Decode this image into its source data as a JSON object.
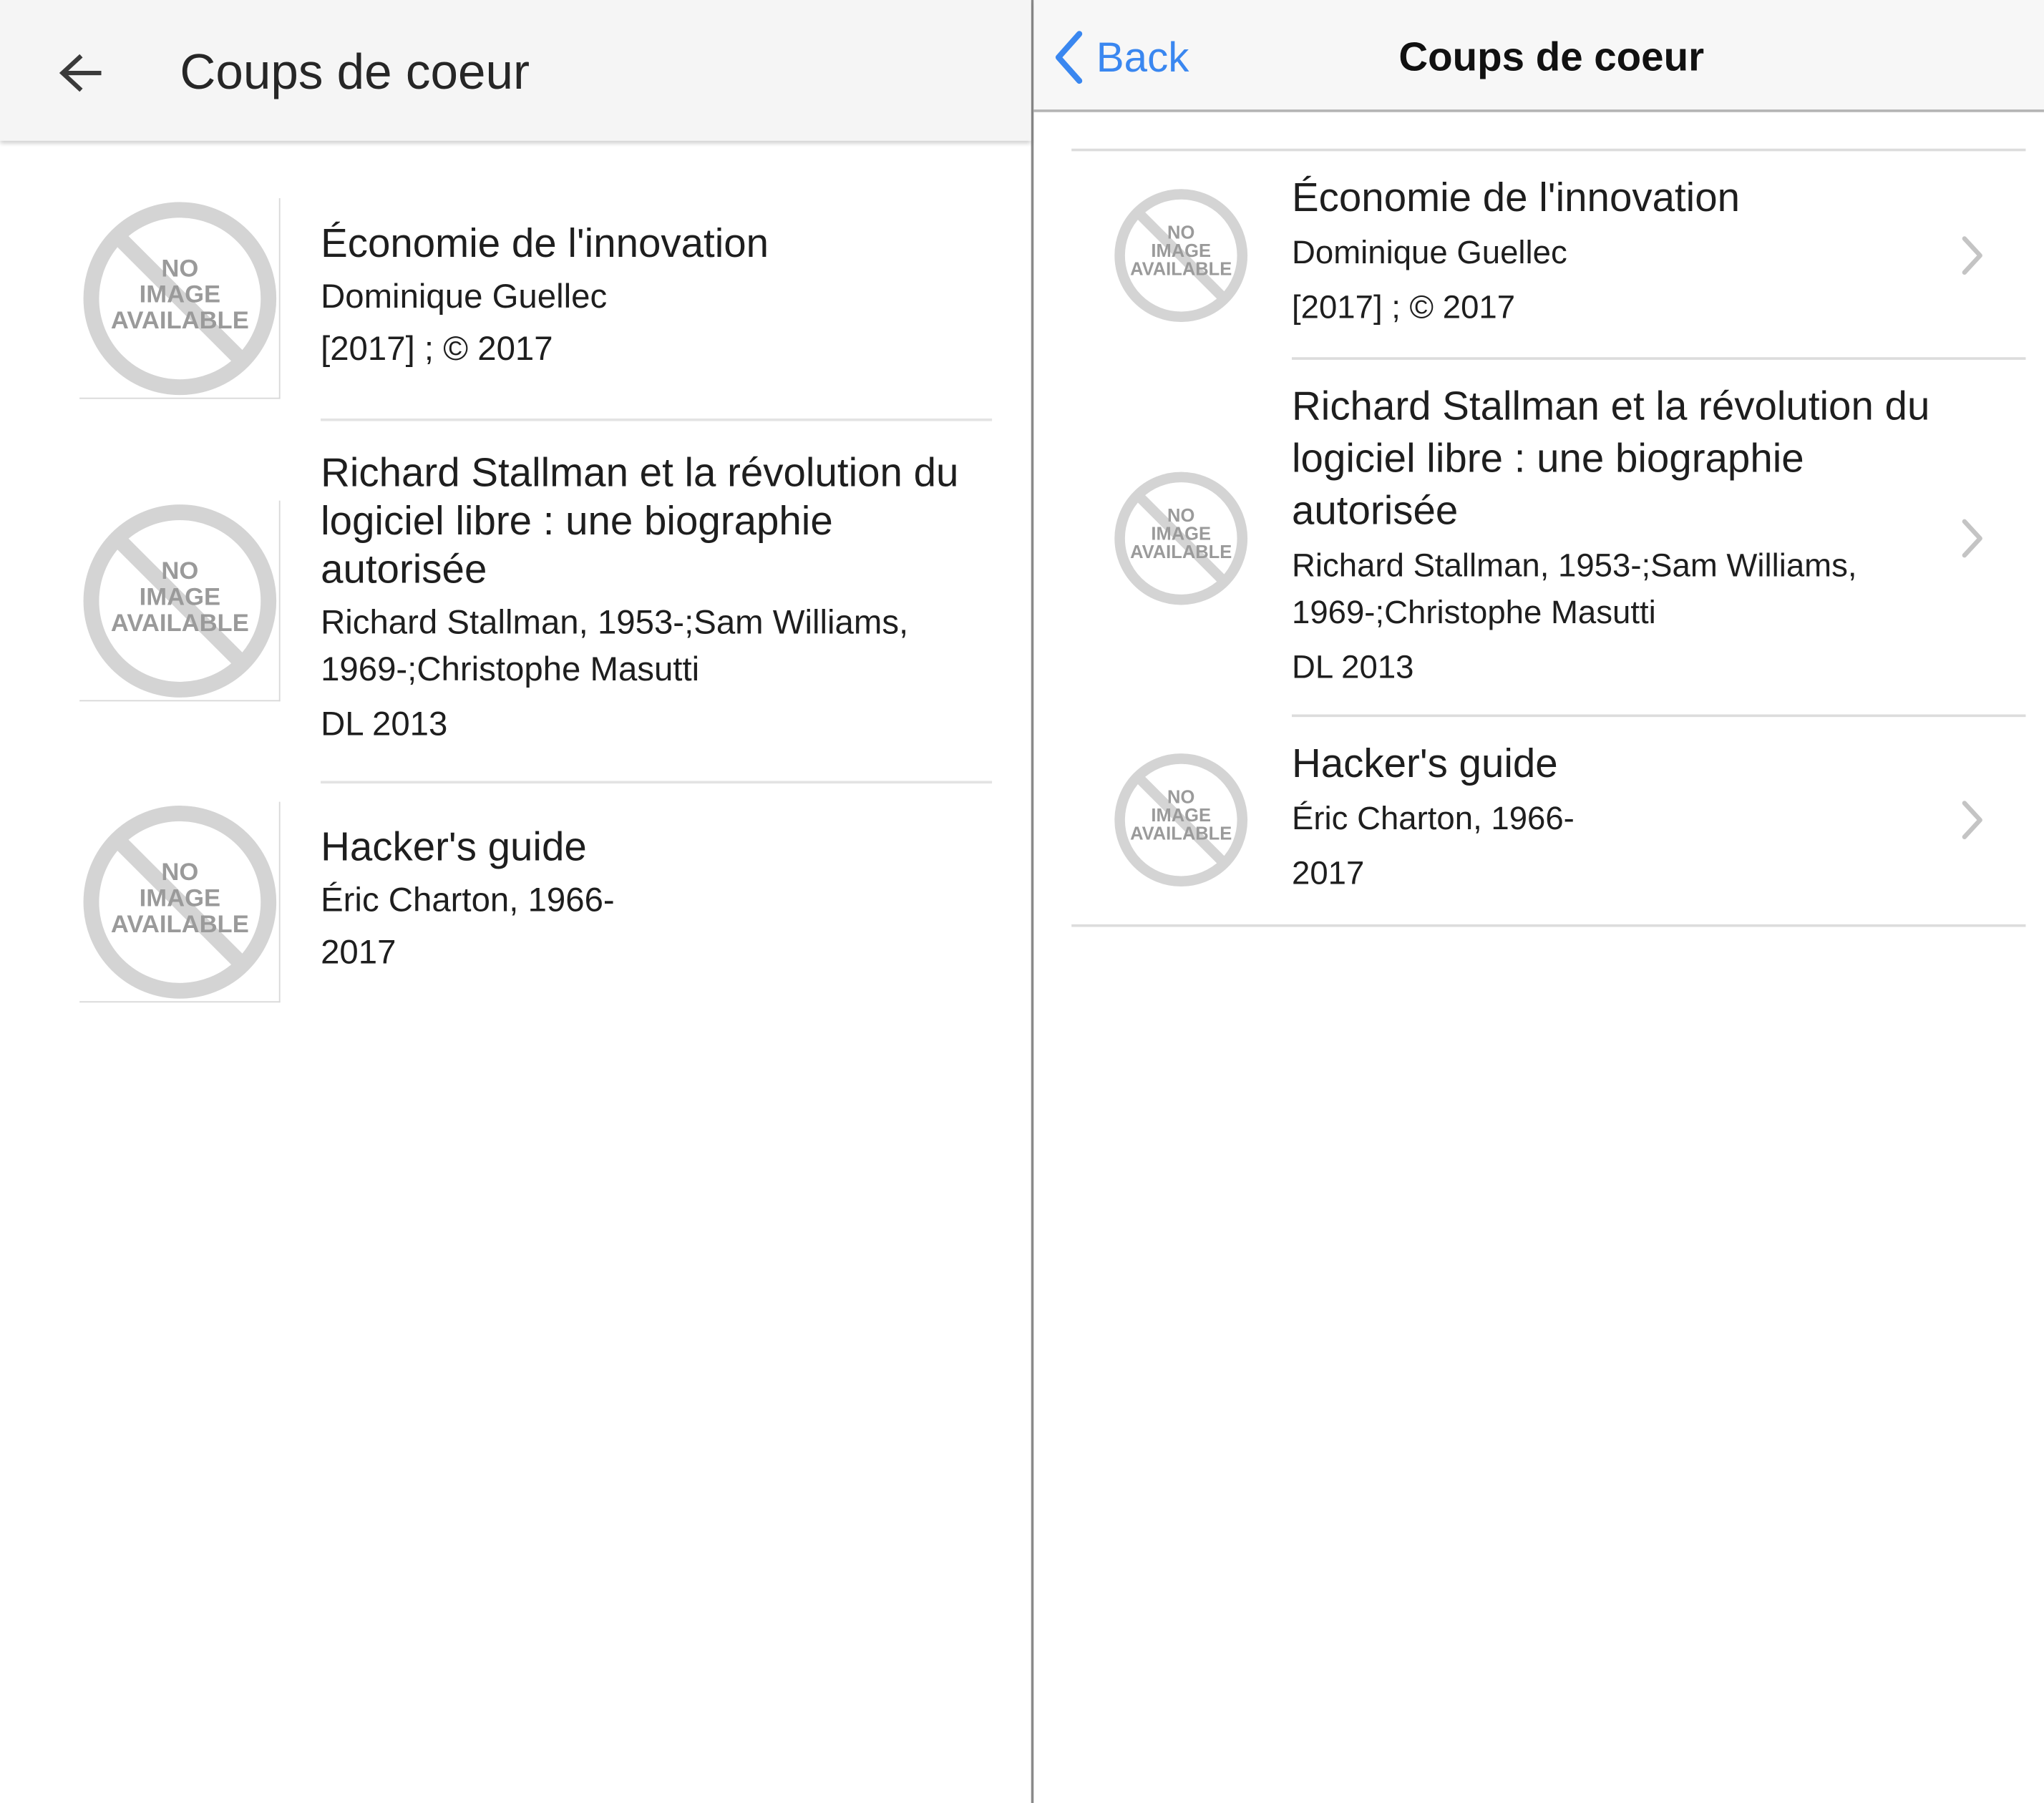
{
  "android": {
    "title": "Coups de coeur",
    "items": [
      {
        "title": "Économie de l'innovation",
        "author": "Dominique Guellec",
        "date": "[2017] ; © 2017"
      },
      {
        "title": "Richard Stallman et la révolution du logiciel libre : une biographie autorisée",
        "author_line1": "Richard Stallman, 1953-;Sam Williams,",
        "author_line2": "1969-;Christophe Masutti",
        "date": "DL 2013"
      },
      {
        "title": "Hacker's guide",
        "author": "Éric Charton, 1966-",
        "date": "2017"
      }
    ]
  },
  "ios": {
    "back_label": "Back",
    "title": "Coups de coeur",
    "items": [
      {
        "title": "Économie de l'innovation",
        "author": "Dominique Guellec",
        "date": "[2017] ; © 2017"
      },
      {
        "title": "Richard Stallman et la révolution du logiciel libre : une biographie autorisée",
        "author_line1": "Richard Stallman, 1953-;Sam Williams,",
        "author_line2": "1969-;Christophe Masutti",
        "date": "DL 2013"
      },
      {
        "title": "Hacker's guide",
        "author": "Éric Charton, 1966-",
        "date": "2017"
      }
    ]
  },
  "placeholder": {
    "line1": "NO",
    "line2": "IMAGE",
    "line3": "AVAILABLE",
    "icon": "no-image-placeholder"
  },
  "colors": {
    "ios_accent": "#3a87f0",
    "placeholder_gray": "#d4d4d4",
    "placeholder_text": "#9a9a9a",
    "divider": "#dcdcdc"
  }
}
